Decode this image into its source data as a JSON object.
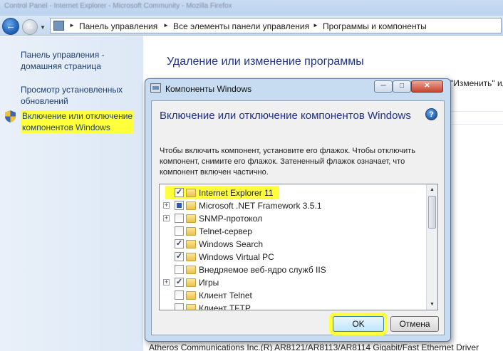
{
  "window": {
    "title_blurred": "Control Panel - Internet Explorer - Microsoft Community - Mozilla Firefox"
  },
  "address": {
    "crumbs": [
      "Панель управления",
      "Все элементы панели управления",
      "Программы и компоненты"
    ]
  },
  "left_pane": {
    "home_link": "Панель управления -\nдомашняя страница",
    "updates_link": "Просмотр установленных\nобновлений",
    "features_link": "Включение или отключение\nкомпонентов Windows"
  },
  "content": {
    "title": "Удаление или изменение программы",
    "peek_text": "\"Изменить\" ил",
    "bottom_text": "Atheros Communications Inc.(R) AR8121/AR8113/AR8114 Gigabit/Fast Ethernet Driver"
  },
  "dialog": {
    "title": "Компоненты Windows",
    "heading": "Включение или отключение компонентов Windows",
    "description": "Чтобы включить компонент, установите его флажок. Чтобы отключить компонент, снимите его флажок. Затененный флажок означает, что компонент включен частично.",
    "ok_label": "OK",
    "cancel_label": "Отмена",
    "features": [
      {
        "label": "Internet Explorer 11",
        "state": "checked",
        "expandable": false
      },
      {
        "label": "Microsoft .NET Framework 3.5.1",
        "state": "partial",
        "expandable": true
      },
      {
        "label": "SNMP-протокол",
        "state": "unchecked",
        "expandable": true
      },
      {
        "label": "Telnet-сервер",
        "state": "unchecked",
        "expandable": false
      },
      {
        "label": "Windows Search",
        "state": "checked",
        "expandable": false
      },
      {
        "label": "Windows Virtual PC",
        "state": "checked",
        "expandable": false
      },
      {
        "label": "Внедряемое веб-ядро служб IIS",
        "state": "unchecked",
        "expandable": false
      },
      {
        "label": "Игры",
        "state": "checked",
        "expandable": true
      },
      {
        "label": "Клиент Telnet",
        "state": "unchecked",
        "expandable": false
      },
      {
        "label": "Клиент TFTP",
        "state": "unchecked",
        "expandable": false
      }
    ]
  },
  "colors": {
    "highlight": "#ffff3c",
    "heading_blue": "#1e3287"
  }
}
